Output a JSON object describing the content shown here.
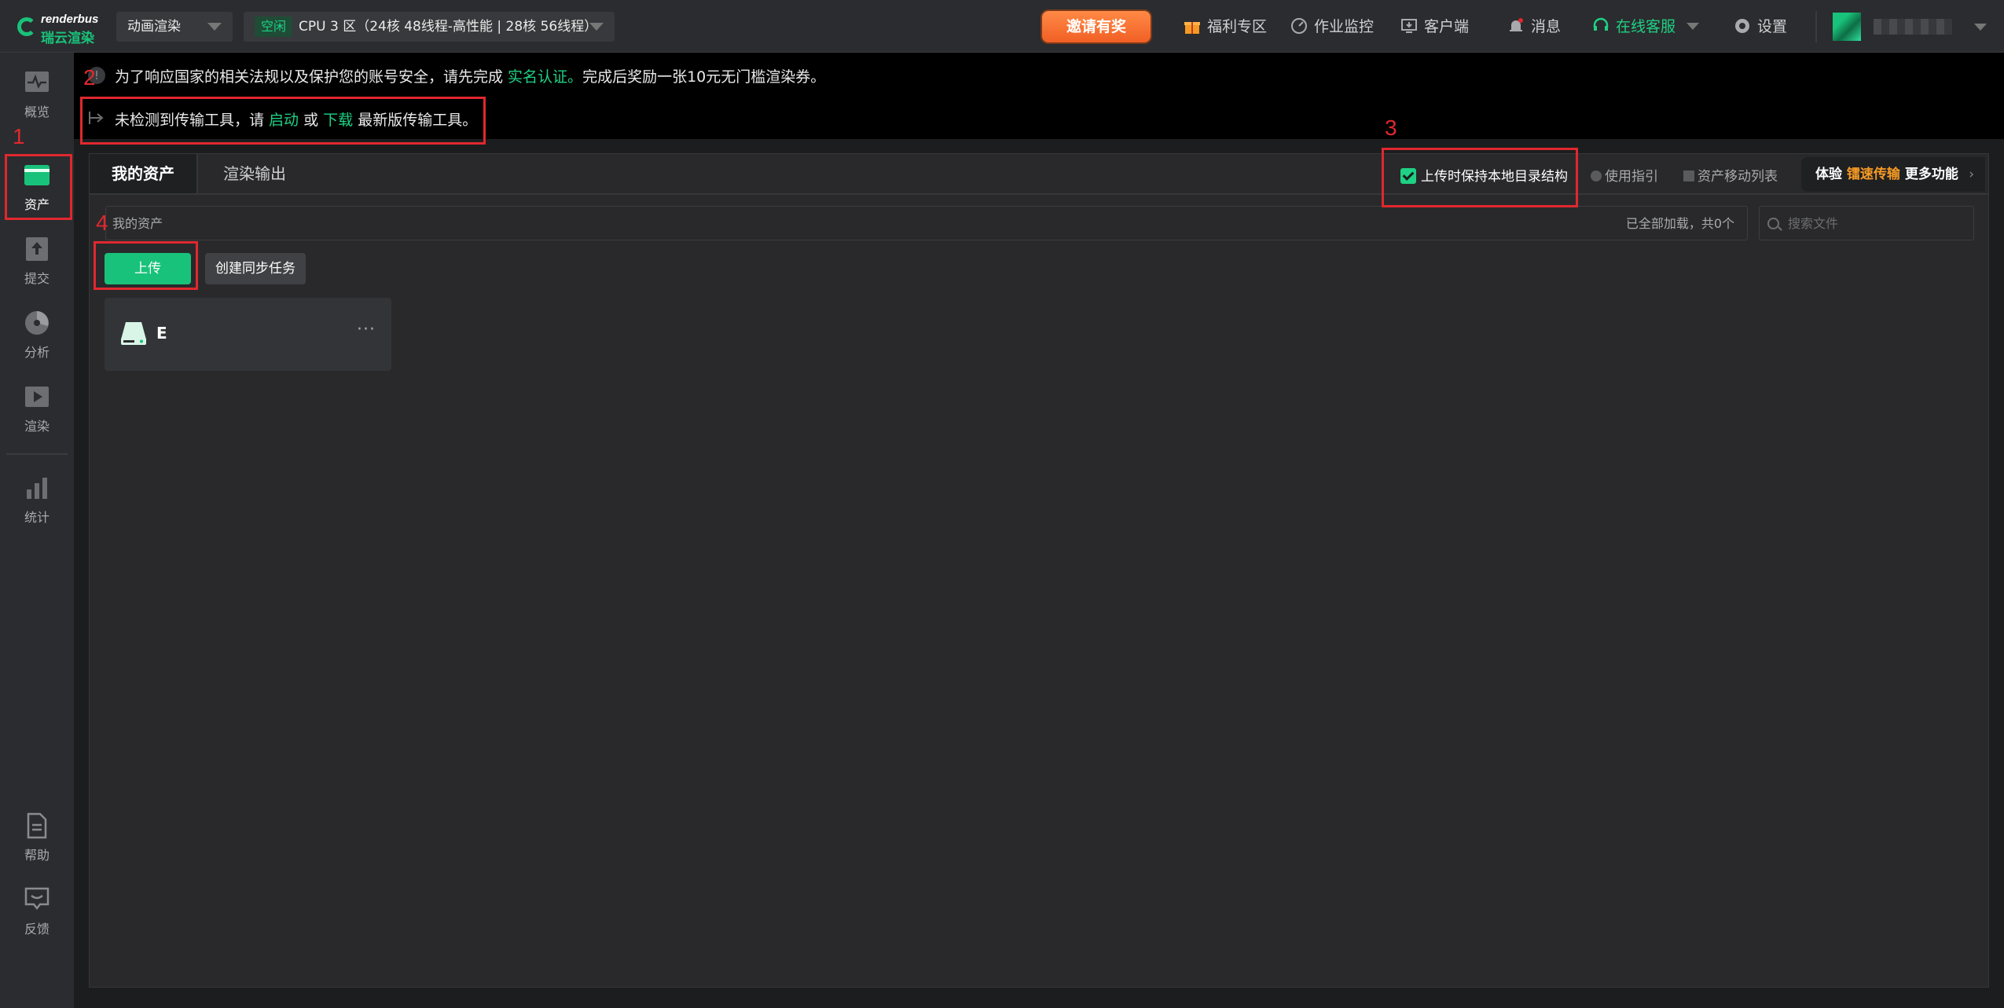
{
  "topbar": {
    "logo_top": "renderbus",
    "logo_bottom": "瑞云渲染",
    "render_type": "动画渲染",
    "cluster_status": "空闲",
    "cluster_label": "CPU 3 区（24核 48线程-高性能 | 28核 56线程）",
    "invite_label": "邀请有奖",
    "nav": {
      "welfare": "福利专区",
      "monitor": "作业监控",
      "client": "客户端",
      "messages": "消息",
      "support": "在线客服",
      "settings": "设置"
    }
  },
  "sidebar": {
    "overview": "概览",
    "assets": "资产",
    "submit": "提交",
    "analyze": "分析",
    "render": "渲染",
    "stats": "统计",
    "help": "帮助",
    "feedback": "反馈"
  },
  "annotations": {
    "n1": "1",
    "n2": "2",
    "n3": "3",
    "n4": "4"
  },
  "notice": {
    "line1_prefix": "为了响应国家的相关法规以及保护您的账号安全，请先完成 ",
    "line1_link": "实名认证。",
    "line1_suffix": "完成后奖励一张10元无门槛渲染券。",
    "line2_prefix": "未检测到传输工具，请 ",
    "line2_start": "启动",
    "line2_or": " 或 ",
    "line2_download": "下载",
    "line2_suffix": " 最新版传输工具。"
  },
  "assets_panel": {
    "tabs": [
      "我的资产",
      "渲染输出"
    ],
    "keep_structure_label": "上传时保持本地目录结构",
    "guide_label": "使用指引",
    "move_list_label": "资产移动列表",
    "promo_prefix": "体验 ",
    "promo_highlight": "镭速传输",
    "promo_suffix": " 更多功能",
    "path_label": "我的资产",
    "load_status": "已全部加载，共0个",
    "search_placeholder": "搜索文件",
    "upload_label": "上传",
    "sync_label": "创建同步任务",
    "drive_name": "E",
    "drive_more": "···"
  },
  "colors": {
    "accent_green": "#19c27a",
    "annotation_red": "#e0282e",
    "invite_orange": "#f15f25"
  }
}
